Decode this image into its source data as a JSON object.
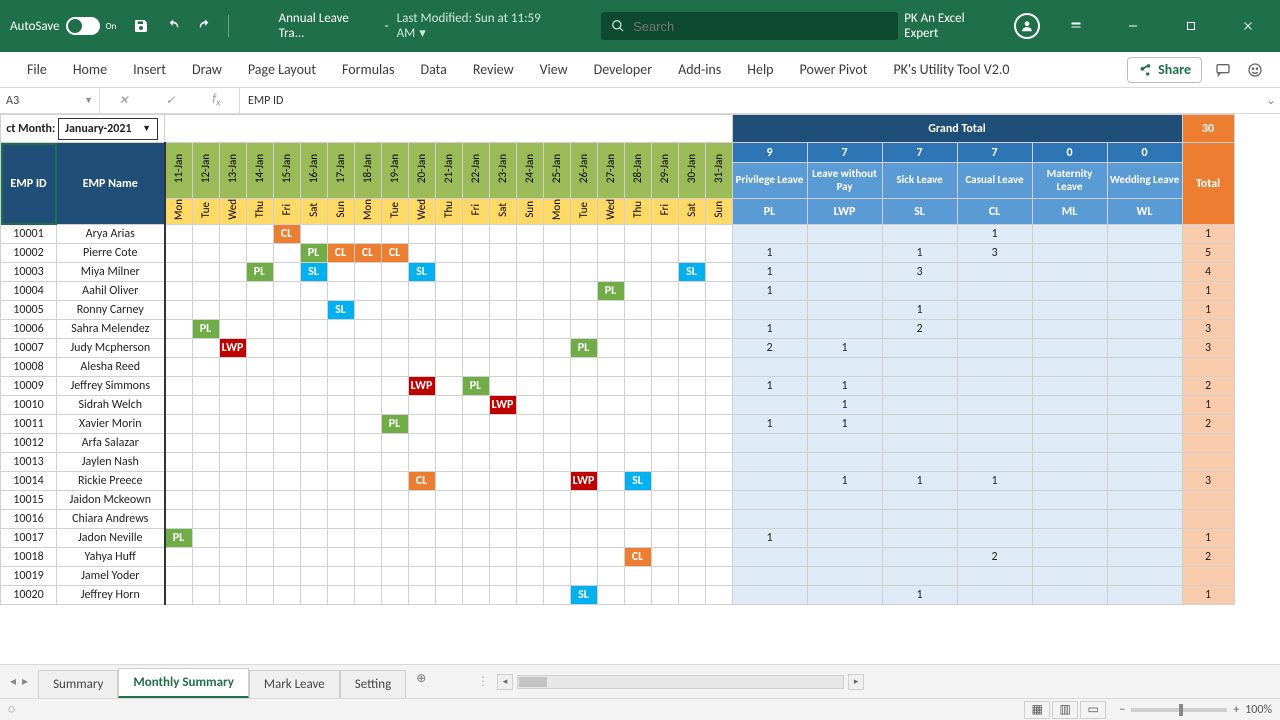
{
  "titlebar": {
    "autosave": "AutoSave",
    "autosave_on": "On",
    "doc_title": "Annual Leave Tra...",
    "modified": "Last Modified: Sun at 11:59 AM",
    "search_placeholder": "Search",
    "user": "PK An Excel Expert"
  },
  "ribbon": {
    "tabs": [
      "File",
      "Home",
      "Insert",
      "Draw",
      "Page Layout",
      "Formulas",
      "Data",
      "Review",
      "View",
      "Developer",
      "Add-ins",
      "Help",
      "Power Pivot",
      "PK's Utility Tool V2.0"
    ],
    "share": "Share"
  },
  "name_box": "A3",
  "fx_value": "EMP ID",
  "month": {
    "label": "ct Month:",
    "value": "January-2021"
  },
  "grand_total_label": "Grand Total",
  "totals_top": {
    "PL": 9,
    "LWP": 7,
    "SL": 7,
    "CL": 7,
    "ML": 0,
    "WL": 0,
    "ALL": 30
  },
  "leave_types": [
    {
      "code": "PL",
      "name": "Privilege Leave"
    },
    {
      "code": "LWP",
      "name": "Leave without Pay"
    },
    {
      "code": "SL",
      "name": "Sick Leave"
    },
    {
      "code": "CL",
      "name": "Casual Leave"
    },
    {
      "code": "ML",
      "name": "Maternity Leave"
    },
    {
      "code": "WL",
      "name": "Wedding Leave"
    }
  ],
  "total_label": "Total",
  "headers": {
    "emp_id": "EMP ID",
    "emp_name": "EMP Name"
  },
  "days": [
    {
      "n": 11,
      "lbl": "11-Jan",
      "d": "Mon"
    },
    {
      "n": 12,
      "lbl": "12-Jan",
      "d": "Tue"
    },
    {
      "n": 13,
      "lbl": "13-Jan",
      "d": "Wed"
    },
    {
      "n": 14,
      "lbl": "14-Jan",
      "d": "Thu"
    },
    {
      "n": 15,
      "lbl": "15-Jan",
      "d": "Fri"
    },
    {
      "n": 16,
      "lbl": "16-Jan",
      "d": "Sat"
    },
    {
      "n": 17,
      "lbl": "17-Jan",
      "d": "Sun"
    },
    {
      "n": 18,
      "lbl": "18-Jan",
      "d": "Mon"
    },
    {
      "n": 19,
      "lbl": "19-Jan",
      "d": "Tue"
    },
    {
      "n": 20,
      "lbl": "20-Jan",
      "d": "Wed"
    },
    {
      "n": 21,
      "lbl": "21-Jan",
      "d": "Thu"
    },
    {
      "n": 22,
      "lbl": "22-Jan",
      "d": "Fri"
    },
    {
      "n": 23,
      "lbl": "23-Jan",
      "d": "Sat"
    },
    {
      "n": 24,
      "lbl": "24-Jan",
      "d": "Sun"
    },
    {
      "n": 25,
      "lbl": "25-Jan",
      "d": "Mon"
    },
    {
      "n": 26,
      "lbl": "26-Jan",
      "d": "Tue"
    },
    {
      "n": 27,
      "lbl": "27-Jan",
      "d": "Wed"
    },
    {
      "n": 28,
      "lbl": "28-Jan",
      "d": "Thu"
    },
    {
      "n": 29,
      "lbl": "29-Jan",
      "d": "Fri"
    },
    {
      "n": 30,
      "lbl": "30-Jan",
      "d": "Sat"
    },
    {
      "n": 31,
      "lbl": "31-Jan",
      "d": "Sun"
    }
  ],
  "rows": [
    {
      "id": "10001",
      "name": "Arya Arias",
      "leaves": {
        "15": "CL"
      },
      "t": {
        "PL": 0,
        "LWP": 0,
        "SL": 0,
        "CL": 1,
        "ML": 0,
        "WL": 0,
        "ALL": 1
      }
    },
    {
      "id": "10002",
      "name": "Pierre Cote",
      "leaves": {
        "16": "PL",
        "17": "CL",
        "18": "CL",
        "19": "CL"
      },
      "t": {
        "PL": 1,
        "LWP": 0,
        "SL": 1,
        "CL": 3,
        "ML": 0,
        "WL": 0,
        "ALL": 5
      }
    },
    {
      "id": "10003",
      "name": "Miya Milner",
      "leaves": {
        "14": "PL",
        "16": "SL",
        "20": "SL",
        "30": "SL"
      },
      "t": {
        "PL": 1,
        "LWP": 0,
        "SL": 3,
        "CL": 0,
        "ML": 0,
        "WL": 0,
        "ALL": 4
      }
    },
    {
      "id": "10004",
      "name": "Aahil Oliver",
      "leaves": {
        "27": "PL"
      },
      "t": {
        "PL": 1,
        "LWP": 0,
        "SL": 0,
        "CL": 0,
        "ML": 0,
        "WL": 0,
        "ALL": 1
      }
    },
    {
      "id": "10005",
      "name": "Ronny Carney",
      "leaves": {
        "17": "SL"
      },
      "t": {
        "PL": 0,
        "LWP": 0,
        "SL": 1,
        "CL": 0,
        "ML": 0,
        "WL": 0,
        "ALL": 1
      }
    },
    {
      "id": "10006",
      "name": "Sahra Melendez",
      "leaves": {
        "12": "PL"
      },
      "t": {
        "PL": 1,
        "LWP": 0,
        "SL": 2,
        "CL": 0,
        "ML": 0,
        "WL": 0,
        "ALL": 3
      }
    },
    {
      "id": "10007",
      "name": "Judy Mcpherson",
      "leaves": {
        "13": "LWP",
        "26": "PL"
      },
      "t": {
        "PL": 2,
        "LWP": 1,
        "SL": 0,
        "CL": 0,
        "ML": 0,
        "WL": 0,
        "ALL": 3
      }
    },
    {
      "id": "10008",
      "name": "Alesha Reed",
      "leaves": {},
      "t": {
        "PL": 0,
        "LWP": 0,
        "SL": 0,
        "CL": 0,
        "ML": 0,
        "WL": 0,
        "ALL": 0
      }
    },
    {
      "id": "10009",
      "name": "Jeffrey Simmons",
      "leaves": {
        "20": "LWP",
        "22": "PL"
      },
      "t": {
        "PL": 1,
        "LWP": 1,
        "SL": 0,
        "CL": 0,
        "ML": 0,
        "WL": 0,
        "ALL": 2
      }
    },
    {
      "id": "10010",
      "name": "Sidrah Welch",
      "leaves": {
        "23": "LWP"
      },
      "t": {
        "PL": 0,
        "LWP": 1,
        "SL": 0,
        "CL": 0,
        "ML": 0,
        "WL": 0,
        "ALL": 1
      }
    },
    {
      "id": "10011",
      "name": "Xavier Morin",
      "leaves": {
        "19": "PL"
      },
      "t": {
        "PL": 1,
        "LWP": 1,
        "SL": 0,
        "CL": 0,
        "ML": 0,
        "WL": 0,
        "ALL": 2
      }
    },
    {
      "id": "10012",
      "name": "Arfa Salazar",
      "leaves": {},
      "t": {
        "PL": 0,
        "LWP": 0,
        "SL": 0,
        "CL": 0,
        "ML": 0,
        "WL": 0,
        "ALL": 0
      }
    },
    {
      "id": "10013",
      "name": "Jaylen Nash",
      "leaves": {},
      "t": {
        "PL": 0,
        "LWP": 0,
        "SL": 0,
        "CL": 0,
        "ML": 0,
        "WL": 0,
        "ALL": 0
      }
    },
    {
      "id": "10014",
      "name": "Rickie Preece",
      "leaves": {
        "20": "CL",
        "26": "LWP",
        "28": "SL"
      },
      "t": {
        "PL": 0,
        "LWP": 1,
        "SL": 1,
        "CL": 1,
        "ML": 0,
        "WL": 0,
        "ALL": 3
      }
    },
    {
      "id": "10015",
      "name": "Jaidon Mckeown",
      "leaves": {},
      "t": {
        "PL": 0,
        "LWP": 0,
        "SL": 0,
        "CL": 0,
        "ML": 0,
        "WL": 0,
        "ALL": 0
      }
    },
    {
      "id": "10016",
      "name": "Chiara Andrews",
      "leaves": {},
      "t": {
        "PL": 0,
        "LWP": 0,
        "SL": 0,
        "CL": 0,
        "ML": 0,
        "WL": 0,
        "ALL": 0
      }
    },
    {
      "id": "10017",
      "name": "Jadon Neville",
      "leaves": {
        "11": "PL"
      },
      "t": {
        "PL": 1,
        "LWP": 0,
        "SL": 0,
        "CL": 0,
        "ML": 0,
        "WL": 0,
        "ALL": 1
      }
    },
    {
      "id": "10018",
      "name": "Yahya Huff",
      "leaves": {
        "28": "CL"
      },
      "t": {
        "PL": 0,
        "LWP": 0,
        "SL": 0,
        "CL": 2,
        "ML": 0,
        "WL": 0,
        "ALL": 2
      }
    },
    {
      "id": "10019",
      "name": "Jamel Yoder",
      "leaves": {},
      "t": {
        "PL": 0,
        "LWP": 0,
        "SL": 0,
        "CL": 0,
        "ML": 0,
        "WL": 0,
        "ALL": 0
      }
    },
    {
      "id": "10020",
      "name": "Jeffrey Horn",
      "leaves": {
        "26": "SL"
      },
      "t": {
        "PL": 0,
        "LWP": 0,
        "SL": 1,
        "CL": 0,
        "ML": 0,
        "WL": 0,
        "ALL": 1
      }
    }
  ],
  "sheet_tabs": [
    "Summary",
    "Monthly Summary",
    "Mark Leave",
    "Setting"
  ],
  "active_tab": 1,
  "zoom": "100%"
}
